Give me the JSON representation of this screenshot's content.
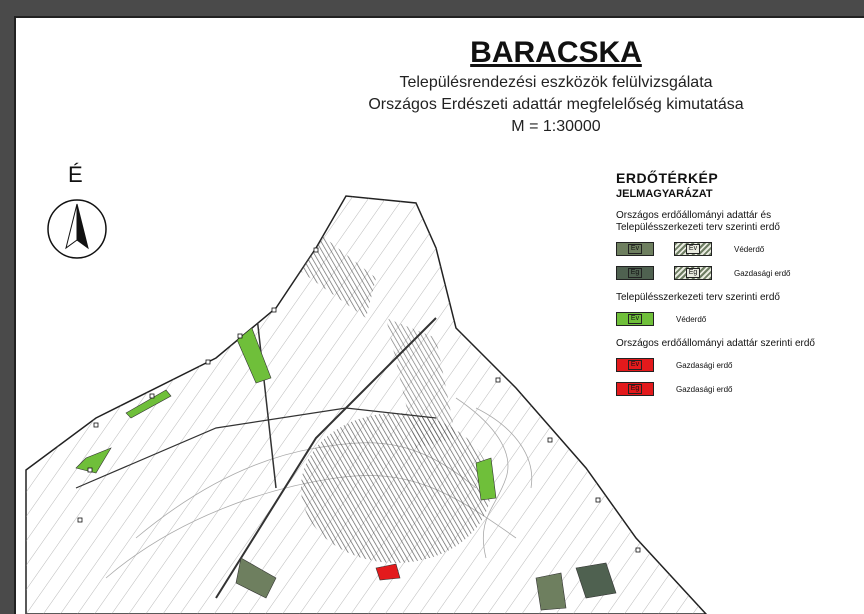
{
  "title": "BARACSKA",
  "subtitle_1": "Településrendezési eszközök felülvizsgálata",
  "subtitle_2": "Országos Erdészeti adattár megfelelőség kimutatása",
  "scale": "M = 1:30000",
  "north_label": "É",
  "legend": {
    "title": "ERDŐTÉRKÉP",
    "subtitle": "JELMAGYARÁZAT",
    "group1_heading": "Országos erdőállományi adattár és Településszerkezeti terv szerinti erdő",
    "group1_rows": [
      {
        "code_a": "Ev",
        "code_b": "Ev",
        "label": "Véderdő",
        "color": "#6e7f5f"
      },
      {
        "code_a": "Eg",
        "code_b": "Eg",
        "label": "Gazdasági erdő",
        "color": "#4f6150"
      }
    ],
    "group2_heading": "Településszerkezeti terv szerinti erdő",
    "group2_rows": [
      {
        "code": "Ev",
        "label": "Véderdő",
        "color": "#6fbf3a"
      }
    ],
    "group3_heading": "Országos erdőállományi adattár szerinti erdő",
    "group3_rows": [
      {
        "code": "Ev",
        "label": "Gazdasági erdő",
        "color": "#e31a1c"
      },
      {
        "code": "Eg",
        "label": "Gazdasági erdő",
        "color": "#e31a1c"
      }
    ]
  },
  "colors": {
    "forest_protective": "#6e7f5f",
    "forest_economic": "#4f6150",
    "plan_forest": "#6fbf3a",
    "registry_forest": "#e31a1c",
    "parcel_lines": "#555555"
  }
}
